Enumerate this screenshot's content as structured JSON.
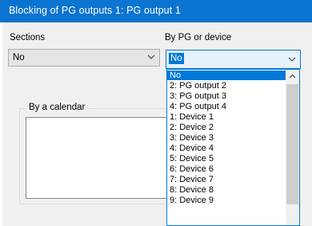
{
  "window": {
    "title": "Blocking of PG outputs 1: PG output 1"
  },
  "sections": {
    "label": "Sections",
    "value": "No"
  },
  "by_pg": {
    "label": "By PG or device",
    "value": "No",
    "options": [
      "No",
      "2: PG output 2",
      "3: PG output 3",
      "4: PG output 4",
      "1: Device 1",
      "2: Device 2",
      "3: Device 3",
      "4: Device 4",
      "5: Device 5",
      "6: Device 6",
      "7: Device 7",
      "8: Device 8",
      "9: Device 9"
    ],
    "selected_index": 0
  },
  "calendar": {
    "label": "By a calendar"
  },
  "colors": {
    "titlebar": "#0a74d0",
    "accent": "#0078d7",
    "window_bg": "#f0f0f0"
  },
  "icons": {
    "combo_arrow": "chevron-down-icon",
    "scroll_up": "chevron-up-icon"
  }
}
